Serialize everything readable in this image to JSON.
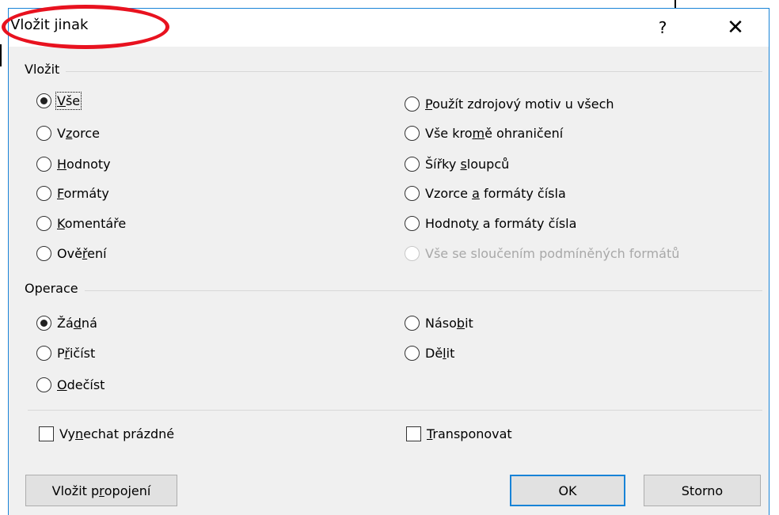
{
  "dialog": {
    "title": "Vložit jinak",
    "help_label": "?",
    "close_label": "✕"
  },
  "paste_group": {
    "label": "Vložit",
    "left": [
      {
        "pre": "",
        "key": "V",
        "post": "še",
        "checked": true,
        "focused": true
      },
      {
        "pre": "V",
        "key": "z",
        "post": "orce"
      },
      {
        "pre": "",
        "key": "H",
        "post": "odnoty"
      },
      {
        "pre": "",
        "key": "F",
        "post": "ormáty"
      },
      {
        "pre": "",
        "key": "K",
        "post": "omentáře"
      },
      {
        "pre": "Ově",
        "key": "ř",
        "post": "ení"
      }
    ],
    "right": [
      {
        "pre": "",
        "key": "P",
        "post": "oužít zdrojový motiv u všech"
      },
      {
        "pre": "Vše kro",
        "key": "m",
        "post": "ě ohraničení"
      },
      {
        "pre": "Šířky ",
        "key": "s",
        "post": "loupců"
      },
      {
        "pre": "Vzorce ",
        "key": "a",
        "post": " formáty čísla"
      },
      {
        "pre": "Hodnot",
        "key": "y",
        "post": " a formáty čísla"
      },
      {
        "pre": "Vše se sloučením podmíněných formátů",
        "key": "",
        "post": "",
        "disabled": true
      }
    ]
  },
  "operation_group": {
    "label": "Operace",
    "left": [
      {
        "pre": "Žá",
        "key": "d",
        "post": "ná",
        "checked": true
      },
      {
        "pre": "P",
        "key": "ř",
        "post": "ičíst"
      },
      {
        "pre": "",
        "key": "O",
        "post": "dečíst"
      }
    ],
    "right": [
      {
        "pre": "Náso",
        "key": "b",
        "post": "it"
      },
      {
        "pre": "Dě",
        "key": "l",
        "post": "it"
      }
    ]
  },
  "checkboxes": {
    "skip_blanks": {
      "pre": "Vy",
      "key": "n",
      "post": "echat prázdné"
    },
    "transpose": {
      "pre": "",
      "key": "T",
      "post": "ransponovat"
    }
  },
  "buttons": {
    "paste_link": {
      "pre": "Vložit p",
      "key": "r",
      "post": "opojení"
    },
    "ok": "OK",
    "cancel": "Storno"
  },
  "colors": {
    "accent_border": "#1883d7",
    "annotation": "#e8121f"
  }
}
